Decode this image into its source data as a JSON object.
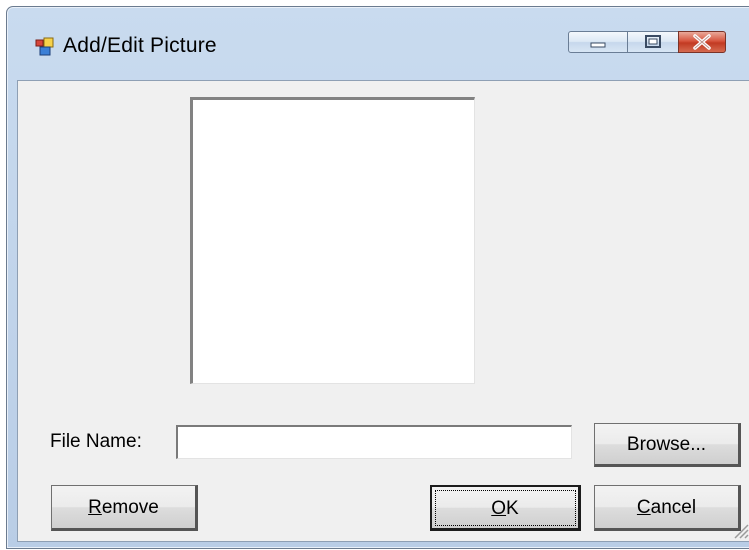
{
  "window": {
    "title": "Add/Edit Picture",
    "icon": "app-window-icon"
  },
  "caption_buttons": {
    "minimize": "minimize-icon",
    "maximize": "maximize-icon",
    "close": "close-icon"
  },
  "form": {
    "file_name_label": "File Name:",
    "file_name_value": "",
    "browse_label": "Browse...",
    "remove_label_mnemonic": "R",
    "remove_label_rest": "emove",
    "ok_label_mnemonic": "O",
    "ok_label_rest": "K",
    "cancel_label_mnemonic": "C",
    "cancel_label_rest": "ancel"
  },
  "colors": {
    "client_background": "#f0f0f0",
    "title_bar": "#b9cde6",
    "close_button": "#c23a22"
  }
}
